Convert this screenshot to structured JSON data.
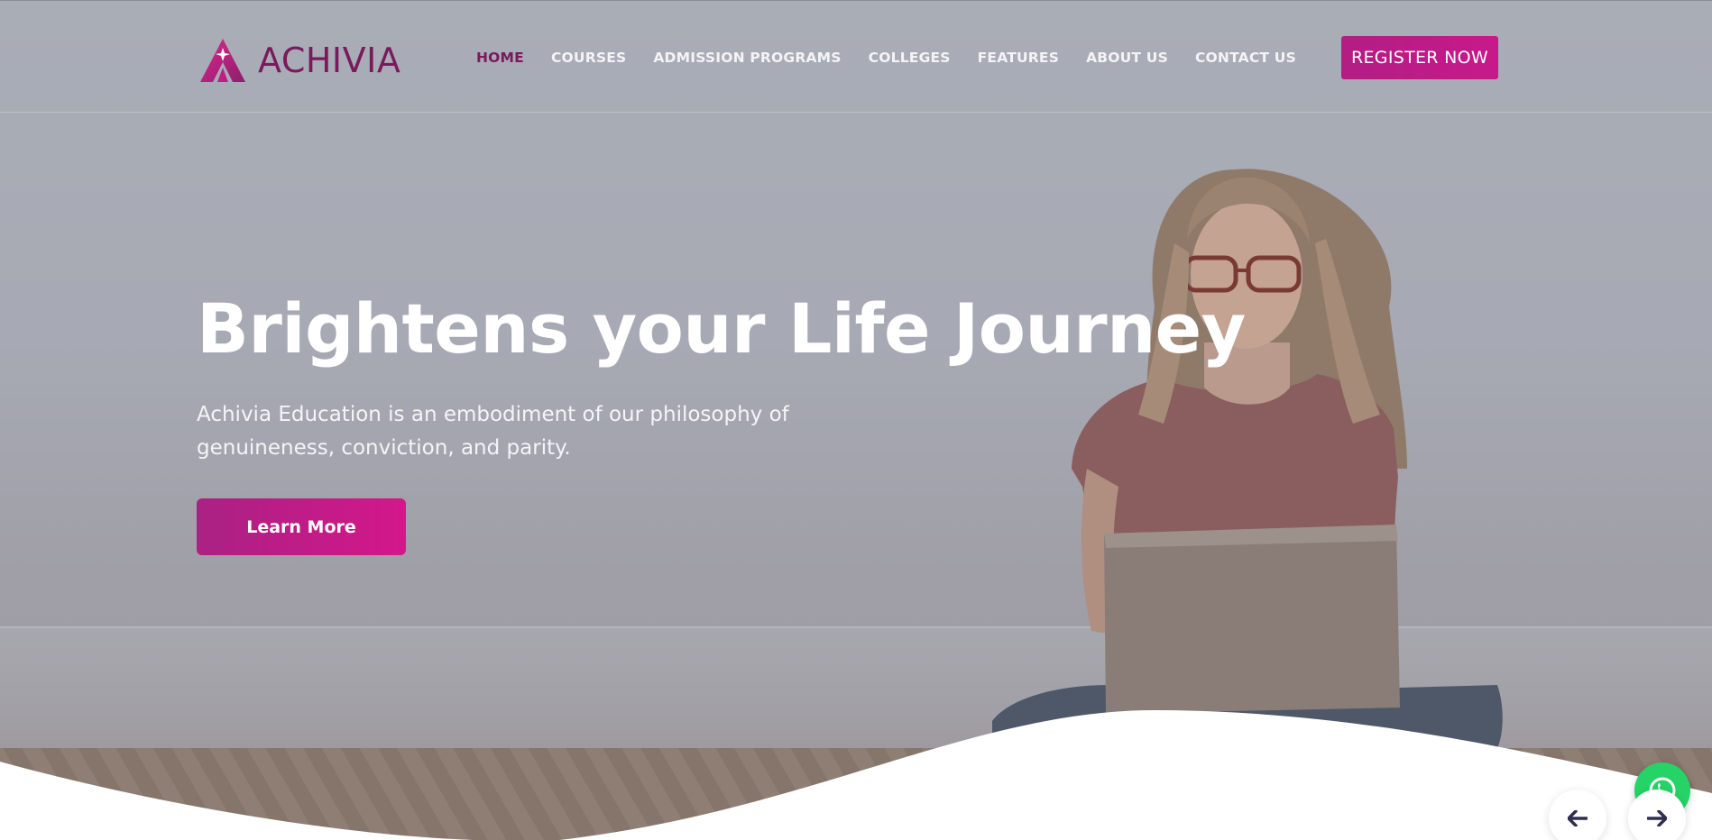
{
  "brand": {
    "name": "ACHIVIA",
    "primary_color": "#7a1a5c",
    "accent_color": "#c8198a"
  },
  "nav": {
    "items": [
      {
        "label": "HOME",
        "active": true
      },
      {
        "label": "COURSES",
        "active": false
      },
      {
        "label": "ADMISSION PROGRAMS",
        "active": false
      },
      {
        "label": "COLLEGES",
        "active": false
      },
      {
        "label": "FEATURES",
        "active": false
      },
      {
        "label": "ABOUT US",
        "active": false
      },
      {
        "label": "CONTACT US",
        "active": false
      }
    ]
  },
  "header": {
    "register_label": "REGISTER NOW"
  },
  "hero": {
    "title": "Brightens your Life Journey",
    "description": "Achivia Education is an embodiment of our philosophy of genuineness, conviction, and parity.",
    "cta_label": "Learn More",
    "image": "student-with-laptop"
  },
  "icons": {
    "chat": "whatsapp-icon",
    "prev": "arrow-left-icon",
    "next": "arrow-right-icon"
  }
}
